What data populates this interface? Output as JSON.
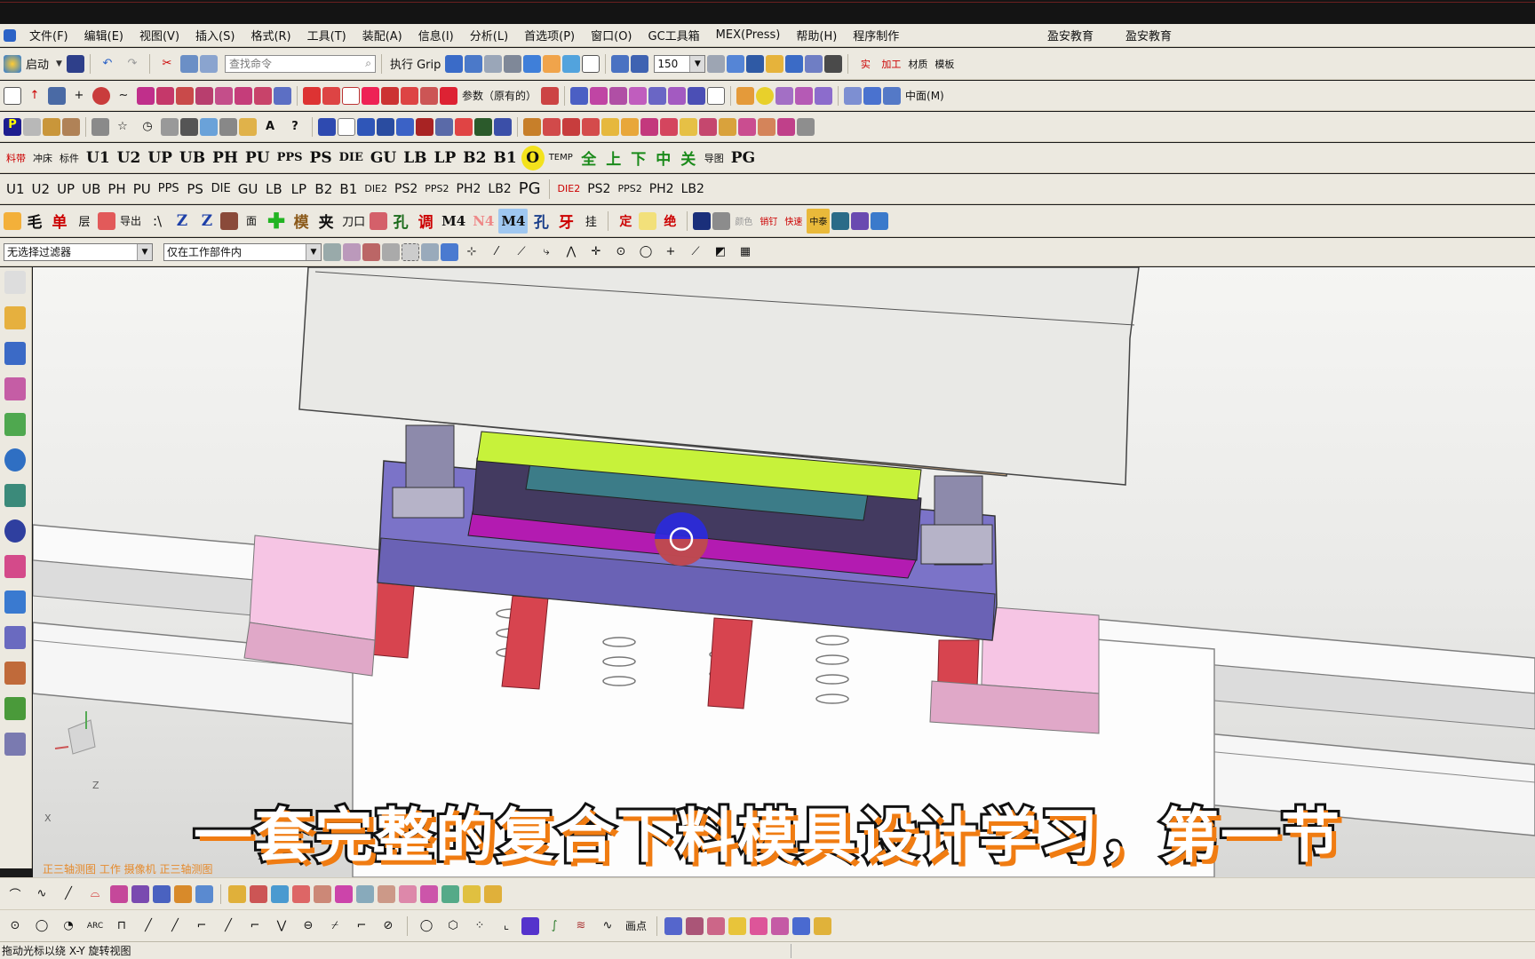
{
  "menu": {
    "items": [
      "文件(F)",
      "编辑(E)",
      "视图(V)",
      "插入(S)",
      "格式(R)",
      "工具(T)",
      "装配(A)",
      "信息(I)",
      "分析(L)",
      "首选项(P)",
      "窗口(O)",
      "GC工具箱",
      "MEX(Press)",
      "帮助(H)",
      "程序制作"
    ],
    "right": [
      "盈安教育",
      "盈安教育"
    ]
  },
  "toolbar1": {
    "start_label": "启动",
    "search_placeholder": "查找命令",
    "grip_label": "执行 Grip",
    "zoom_value": "150",
    "right_labels": [
      "实",
      "加工",
      "材质",
      "模板"
    ]
  },
  "toolbar2": {
    "param_label": "参数（原有的）",
    "mid_label": "中面(M)"
  },
  "toolbar4": {
    "buttons": [
      "料带",
      "冲床",
      "标件",
      "U1",
      "U2",
      "UP",
      "UB",
      "PH",
      "PU",
      "PPS",
      "PS",
      "DIE",
      "GU",
      "LB",
      "LP",
      "B2",
      "B1",
      "O",
      "TEMP",
      "全",
      "上",
      "下",
      "中",
      "关",
      "导图",
      "PG"
    ]
  },
  "toolbar5": {
    "buttons": [
      "U1",
      "U2",
      "UP",
      "UB",
      "PH",
      "PU",
      "PPS",
      "PS",
      "DIE",
      "GU",
      "LB",
      "LP",
      "B2",
      "B1",
      "DIE2",
      "PS2",
      "PPS2",
      "PH2",
      "LB2",
      "PG",
      "DIE2",
      "PS2",
      "PPS2",
      "PH2",
      "LB2"
    ]
  },
  "toolbar6": {
    "buttons": [
      "毛",
      "单",
      "层",
      "导出",
      ":\\",
      "Z",
      "Z",
      "面",
      "模",
      "夹",
      "刀口",
      "孔",
      "调",
      "M4",
      "N4",
      "M4",
      "孔",
      "牙",
      "挂",
      "定",
      "绝",
      "颜色",
      "销钉",
      "快速",
      "中泰"
    ]
  },
  "filter": {
    "selection_filter": "无选择过滤器",
    "scope": "仅在工作部件内"
  },
  "viewport": {
    "view_label": "正三轴测图 工作 摄像机 正三轴测图",
    "axis_x": "X",
    "axis_z": "Z"
  },
  "subtitle": "一套完整的复合下料模具设计学习，第一节",
  "status": {
    "message": "拖动光标以绕 X-Y 旋转视图"
  },
  "bottom_toolbar2": {
    "point_label": "画点"
  },
  "colors": {
    "upper_plate": "#e9e9e6",
    "upper_pad": "#e2b98b",
    "green_plate": "#c7f23a",
    "magenta_plate": "#b31bb1",
    "lower_plate": "#7b73c8",
    "pink_block": "#f6c5e4",
    "red_leg": "#d7444f",
    "subtitle_outline": "#f07c12"
  }
}
